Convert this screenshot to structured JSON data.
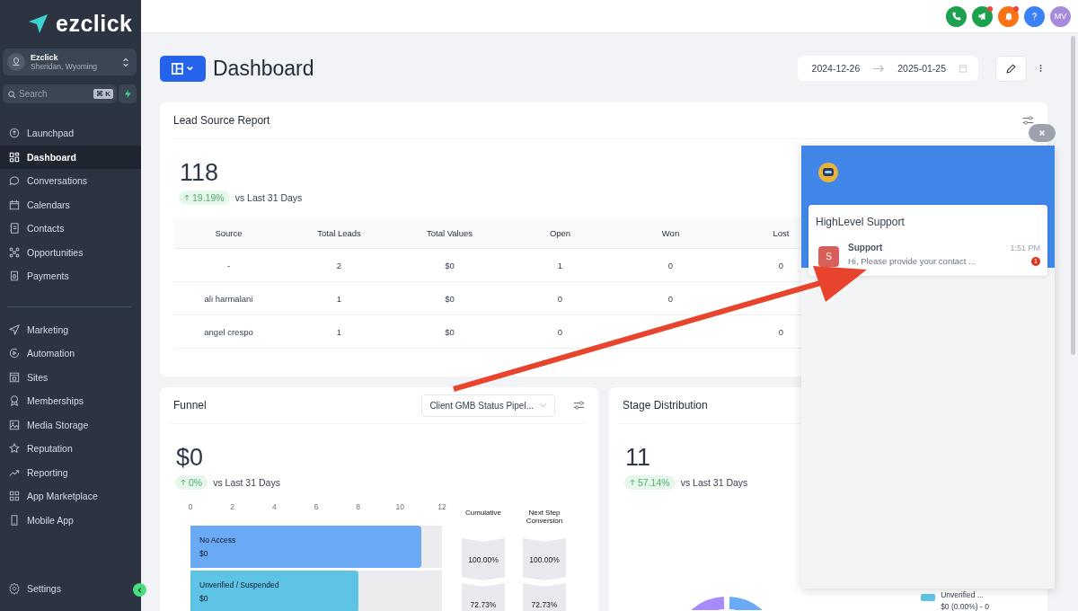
{
  "sidebar": {
    "brand": "ezclick",
    "account": {
      "name": "Ezclick",
      "location": "Sheridan, Wyoming"
    },
    "search": {
      "placeholder": "Search",
      "shortcut": "⌘ K"
    },
    "groups": [
      [
        {
          "label": "Launchpad",
          "selected": false
        },
        {
          "label": "Dashboard",
          "selected": true
        },
        {
          "label": "Conversations",
          "selected": false
        },
        {
          "label": "Calendars",
          "selected": false
        },
        {
          "label": "Contacts",
          "selected": false
        },
        {
          "label": "Opportunities",
          "selected": false
        },
        {
          "label": "Payments",
          "selected": false
        }
      ],
      [
        {
          "label": "Marketing",
          "selected": false
        },
        {
          "label": "Automation",
          "selected": false
        },
        {
          "label": "Sites",
          "selected": false
        },
        {
          "label": "Memberships",
          "selected": false
        },
        {
          "label": "Media Storage",
          "selected": false
        },
        {
          "label": "Reputation",
          "selected": false
        },
        {
          "label": "Reporting",
          "selected": false
        },
        {
          "label": "App Marketplace",
          "selected": false
        },
        {
          "label": "Mobile App",
          "selected": false
        }
      ]
    ],
    "settings": "Settings"
  },
  "topbar": {
    "avatar": "MV"
  },
  "header": {
    "title": "Dashboard",
    "date_from": "2024-12-26",
    "date_to": "2025-01-25"
  },
  "lead_source": {
    "title": "Lead Source Report",
    "total": "118",
    "change": "19.19%",
    "comparison": "vs Last 31 Days",
    "columns": [
      "Source",
      "Total Leads",
      "Total Values",
      "Open",
      "Won",
      "Lost"
    ],
    "rows": [
      [
        "-",
        "2",
        "$0",
        "1",
        "0",
        "0"
      ],
      [
        "ali harmalani",
        "1",
        "$0",
        "0",
        "0"
      ],
      [
        "angel crespo",
        "1",
        "$0",
        "0",
        null,
        "0"
      ]
    ]
  },
  "funnel": {
    "title": "Funnel",
    "pipeline": "Client GMB Status Pipel...",
    "total": "$0",
    "change": "0%",
    "comparison": "vs Last 31 Days",
    "cumulative_label": "Cumulative",
    "conversion_label": "Next Step Conversion",
    "stages": [
      {
        "amount": "$0",
        "cumulative": "100.00%",
        "conversion": "100.00%",
        "color": "#6aa9f4"
      },
      {
        "amount": "$0",
        "cumulative": "72.73%",
        "conversion": "72.73%",
        "color": "#5ec4e6"
      }
    ],
    "chart_data": {
      "type": "bar",
      "orientation": "horizontal",
      "categories": [
        "No Access",
        "Unverified / Suspended"
      ],
      "values": [
        11,
        8
      ],
      "xlim": [
        0,
        12
      ],
      "xticks": [
        0,
        2,
        4,
        6,
        8,
        10,
        12
      ]
    }
  },
  "stage_distribution": {
    "title": "Stage Distribution",
    "total": "11",
    "change": "57.14%",
    "comparison": "vs Last 31 Days",
    "legend": [
      {
        "label": "Unverified ...",
        "detail": "$0 (0.00%) - 0",
        "color": "#5ec4e6"
      }
    ]
  },
  "chat_widget": {
    "title": "HighLevel Support",
    "conversations": [
      {
        "initial": "S",
        "name": "Support",
        "time": "1:51 PM",
        "preview": "Hi, Please provide your contact ...",
        "unread": "1"
      }
    ]
  }
}
